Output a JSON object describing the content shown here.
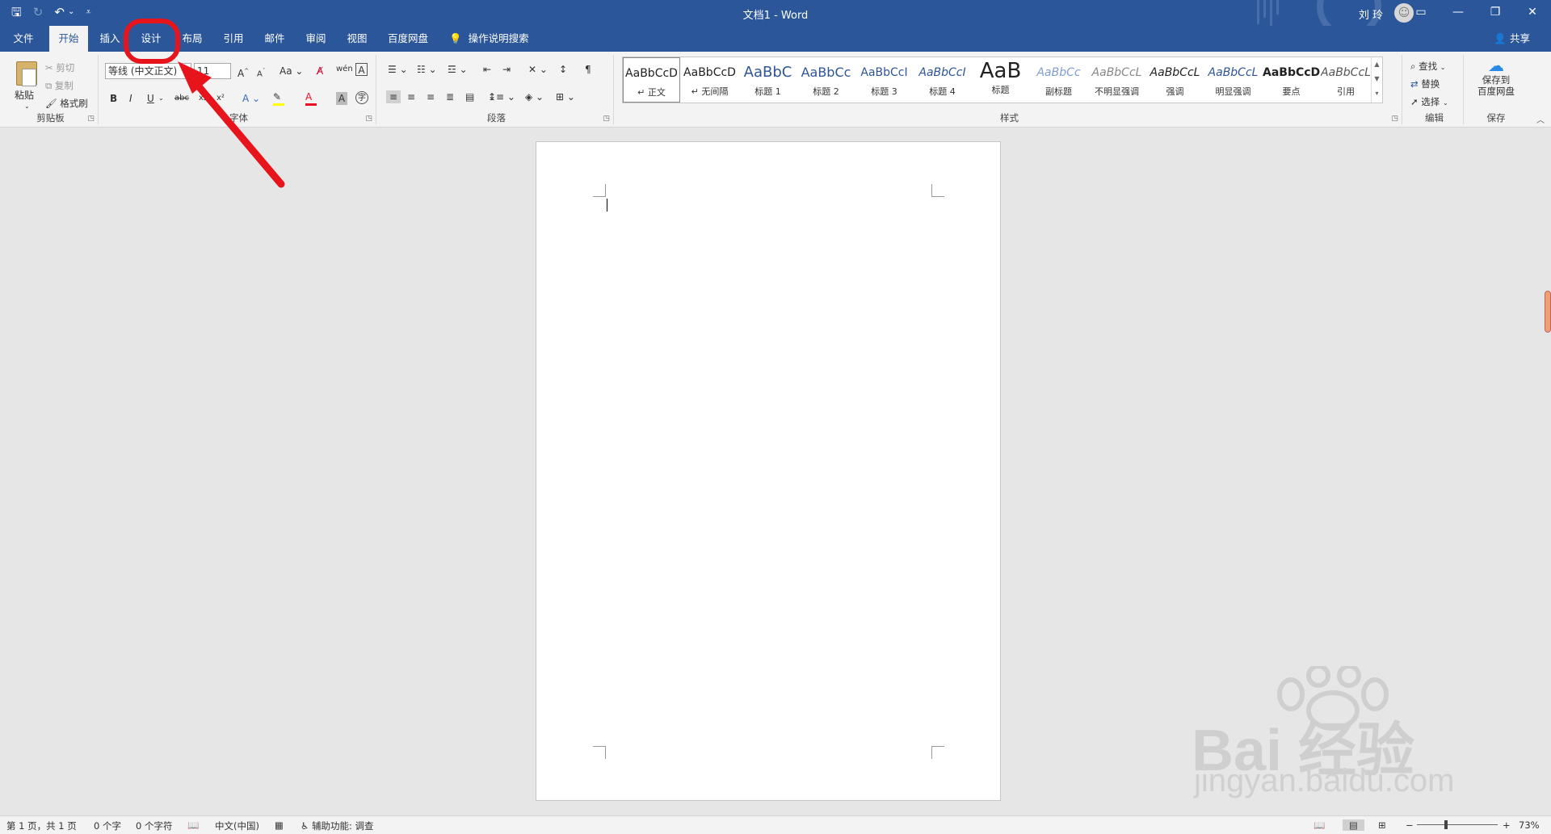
{
  "titlebar": {
    "title": "文档1  -  Word",
    "user_name": "刘 玲",
    "qat": {
      "save": "🖫",
      "redo": "↻",
      "undo": "↶",
      "undo_menu": "⌄",
      "customize": "⩡"
    },
    "window": {
      "ribbon_display": "▭",
      "minimize": "—",
      "restore": "❐",
      "close": "✕"
    }
  },
  "tabs": [
    {
      "label": "文件"
    },
    {
      "label": "开始"
    },
    {
      "label": "插入"
    },
    {
      "label": "设计"
    },
    {
      "label": "布局"
    },
    {
      "label": "引用"
    },
    {
      "label": "邮件"
    },
    {
      "label": "审阅"
    },
    {
      "label": "视图"
    },
    {
      "label": "百度网盘"
    }
  ],
  "tell_me": "操作说明搜索",
  "share": "共享",
  "ribbon": {
    "clipboard": {
      "label": "剪贴板",
      "paste": "粘贴",
      "cut": "剪切",
      "copy": "复制",
      "format_painter": "格式刷"
    },
    "font": {
      "label": "字体",
      "font_name": "等线 (中文正文)",
      "font_size": "11"
    },
    "paragraph": {
      "label": "段落"
    },
    "styles": {
      "label": "样式",
      "items": [
        {
          "preview": "AaBbCcD",
          "name": "↵ 正文"
        },
        {
          "preview": "AaBbCcD",
          "name": "↵ 无间隔"
        },
        {
          "preview": "AaBbC",
          "name": "标题 1"
        },
        {
          "preview": "AaBbCc",
          "name": "标题 2"
        },
        {
          "preview": "AaBbCcI",
          "name": "标题 3"
        },
        {
          "preview": "AaBbCcI",
          "name": "标题 4"
        },
        {
          "preview": "AaB",
          "name": "标题"
        },
        {
          "preview": "AaBbCc",
          "name": "副标题"
        },
        {
          "preview": "AaBbCcL",
          "name": "不明显强调"
        },
        {
          "preview": "AaBbCcL",
          "name": "强调"
        },
        {
          "preview": "AaBbCcL",
          "name": "明显强调"
        },
        {
          "preview": "AaBbCcD",
          "name": "要点"
        },
        {
          "preview": "AaBbCcL",
          "name": "引用"
        }
      ]
    },
    "editing": {
      "label": "编辑",
      "find": "查找",
      "replace": "替换",
      "select": "选择"
    },
    "save_group": {
      "label": "保存",
      "line1": "保存到",
      "line2": "百度网盘"
    }
  },
  "statusbar": {
    "page": "第 1 页，共 1 页",
    "words": "0 个字",
    "chars": "0 个字符",
    "language": "中文(中国)",
    "accessibility": "辅助功能: 调查",
    "zoom": "73%"
  },
  "watermark": {
    "text": "Bai 经验",
    "url": "jingyan.baidu.com"
  },
  "colors": {
    "accent": "#2b579a",
    "annotation": "#e8141c",
    "font_color_bar": "#e81123",
    "highlight_bar": "#ffff00"
  }
}
